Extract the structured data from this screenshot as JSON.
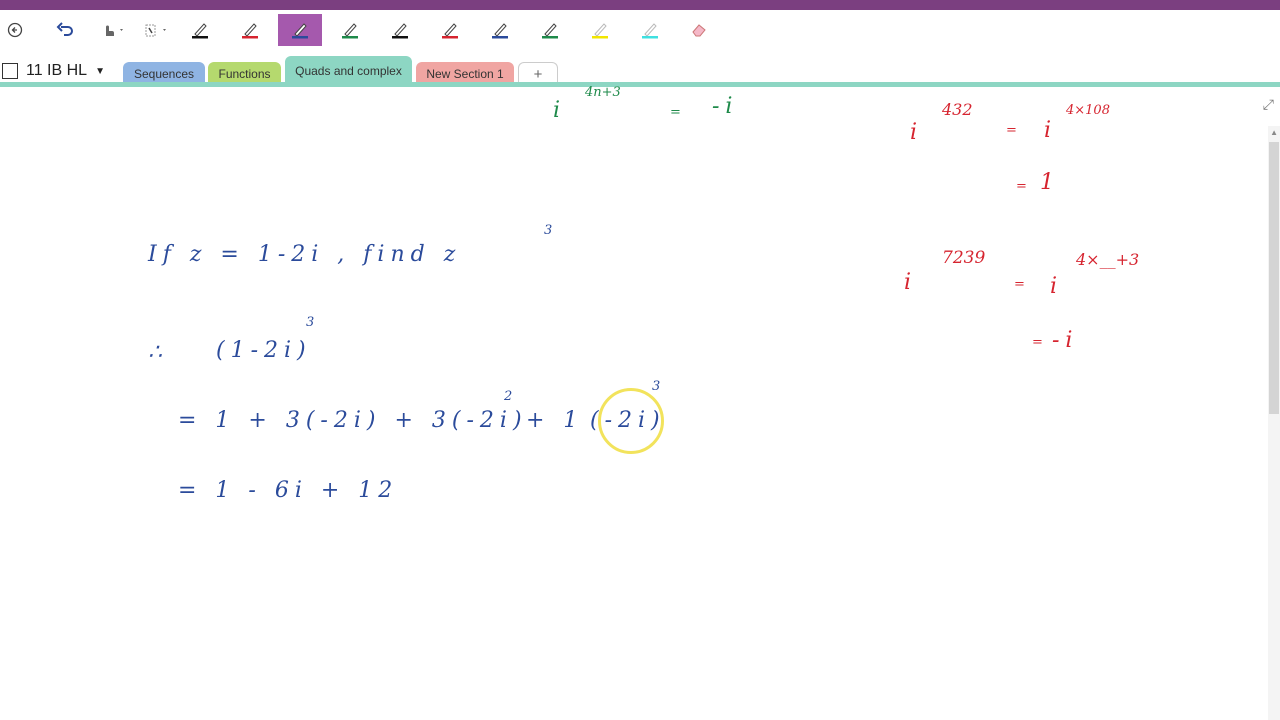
{
  "toolbar": {
    "buttons": [
      {
        "name": "back-icon"
      },
      {
        "name": "undo-icon"
      },
      {
        "name": "touch-draw-icon"
      },
      {
        "name": "lasso-select-icon"
      }
    ],
    "pens": [
      {
        "color": "#111111"
      },
      {
        "color": "#d6242f"
      },
      {
        "color": "#2b4b9b",
        "selected": true
      },
      {
        "color": "#1e8a4a"
      },
      {
        "color": "#111111"
      },
      {
        "color": "#d6242f"
      },
      {
        "color": "#2b4b9b"
      },
      {
        "color": "#1e8a4a"
      },
      {
        "color": "#f2e600"
      },
      {
        "color": "#3fe0e0"
      }
    ],
    "eraser": "eraser-icon"
  },
  "notebook": {
    "name": "11 IB HL"
  },
  "tabs": [
    {
      "label": "Sequences",
      "color": "#8fb4e3"
    },
    {
      "label": "Functions",
      "color": "#b5d96e"
    },
    {
      "label": "Quads and complex",
      "color": "#8dd6c3",
      "active": true
    },
    {
      "label": "New Section 1",
      "color": "#f0a5a2"
    },
    {
      "label": "+",
      "color": "#ffffff"
    }
  ],
  "ink": {
    "green_top": {
      "base": "i",
      "exp": "4n+3",
      "eq": "=",
      "rhs": "-i"
    },
    "red1": {
      "base": "i",
      "exp": "432",
      "eq": "=",
      "rhs_base": "i",
      "rhs_exp": "4×108"
    },
    "red1b": {
      "eq": "=",
      "val": "1"
    },
    "red2": {
      "base": "i",
      "exp": "7239",
      "eq": "=",
      "rhs_base": "i",
      "rhs_exp": "4×__+3"
    },
    "red2b": {
      "eq": "=",
      "val": "-i"
    },
    "line1": {
      "text": "If   z = 1-2i ,  find  z",
      "exp": "3"
    },
    "line2": {
      "lead": "∴",
      "text": "(1-2i)",
      "exp": "3"
    },
    "line3": {
      "text": "=  1 + 3(-2i) + 3(-2i)",
      "exp2": "2",
      "tail": "+  1",
      "paren": "(-2i)",
      "exp3": "3"
    },
    "line4": {
      "text": "=   1  - 6i   + 12"
    }
  }
}
